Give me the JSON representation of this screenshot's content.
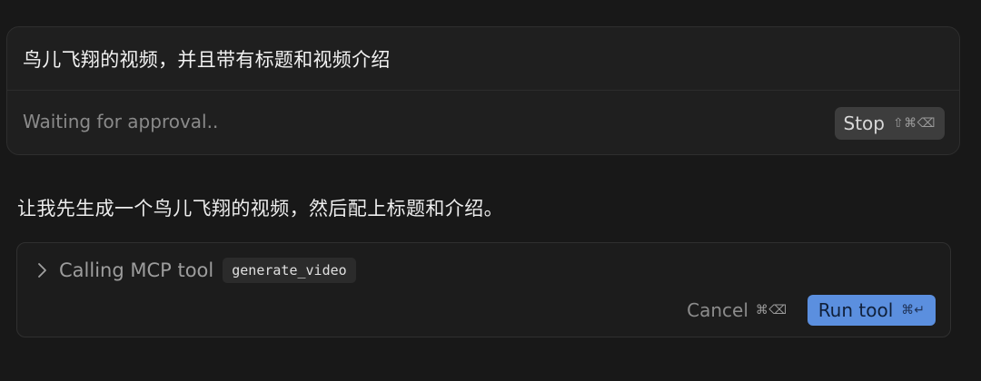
{
  "prompt": {
    "text": "鸟儿飞翔的视频，并且带有标题和视频介绍",
    "status": "Waiting for approval..",
    "stop_label": "Stop",
    "stop_shortcut": "⇧⌘⌫"
  },
  "assistant": {
    "message": "让我先生成一个鸟儿飞翔的视频，然后配上标题和介绍。"
  },
  "tool_call": {
    "title": "Calling MCP tool",
    "tool_name": "generate_video",
    "cancel_label": "Cancel",
    "cancel_shortcut": "⌘⌫",
    "run_label": "Run tool",
    "run_shortcut": "⌘↵",
    "expand_icon": "chevron-right-icon"
  },
  "colors": {
    "background": "#181818",
    "accent": "#5b8fdf"
  }
}
